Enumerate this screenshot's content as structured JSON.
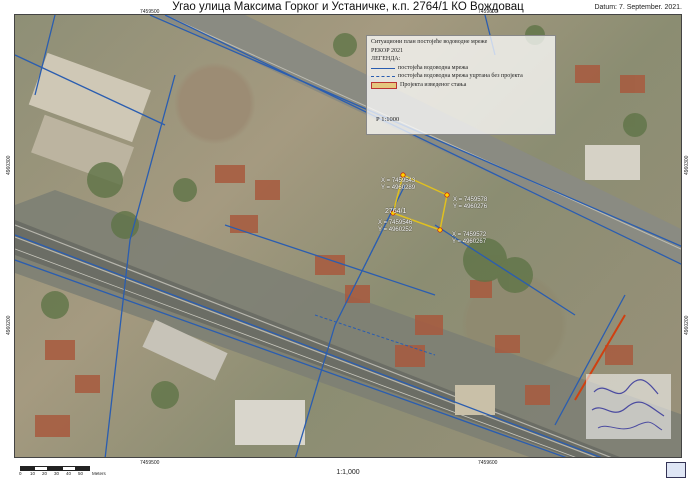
{
  "title": "Угао улица Максима Горког и Устаничке, к.п. 2764/1 КО Вождовац",
  "date": "Datum: 7. September. 2021.",
  "grid": {
    "top_x": [
      "7459500",
      "7459600"
    ],
    "bottom_x": [
      "7459500",
      "7459600"
    ],
    "left_y": [
      "4960300",
      "4960200"
    ],
    "right_y": [
      "4960300",
      "4960200"
    ]
  },
  "legend": {
    "line1": "Ситуациони план постојеће водоводне мреже",
    "line2": "РЕКОР 2021",
    "heading": "ЛЕГЕНДА:",
    "items": [
      "постојећа водоводна мрежа",
      "постојећа водоводна мрежа уцртана без пројекта",
      "Пројекта изведеног стања"
    ]
  },
  "map_scale_label": "Р 1:1000",
  "parcel": {
    "number": "2764/1",
    "points": [
      "X = 7459543\nY = 4960289",
      "X = 7459578\nY = 4960276",
      "X = 7459546\nY = 4960252",
      "X = 7459572\nY = 4960267"
    ]
  },
  "scale_bar": {
    "ticks": [
      "0",
      "10",
      "20",
      "30",
      "40",
      "50"
    ],
    "unit": "Meters"
  },
  "scale_text": "1:1,000",
  "colors": {
    "network": "#2a5db0",
    "parcel_outline": "#e0c020",
    "highlight_line": "#d04010"
  }
}
